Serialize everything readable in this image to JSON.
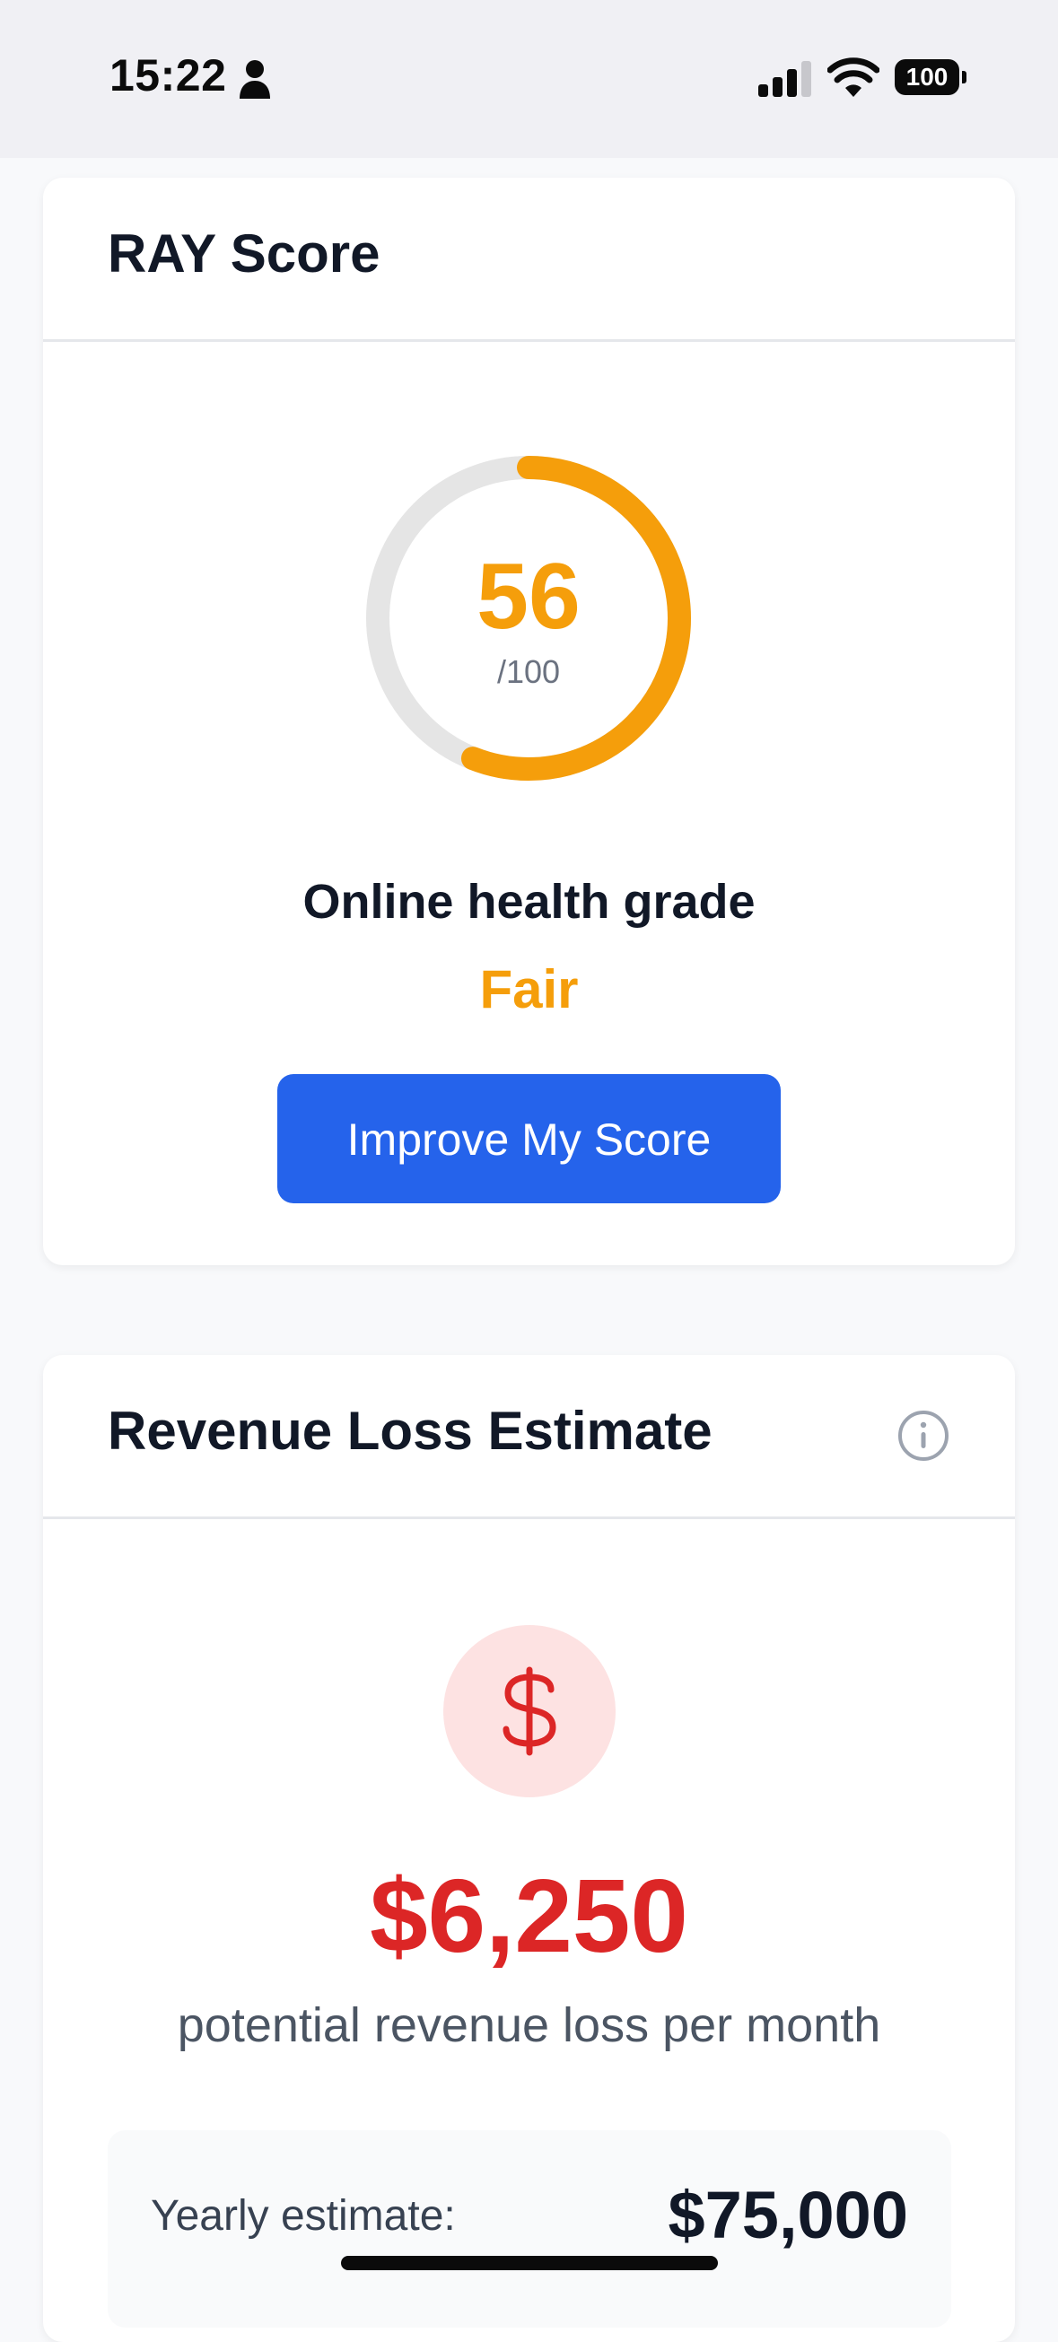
{
  "status_bar": {
    "time": "15:22",
    "battery": "100"
  },
  "score_card": {
    "title": "RAY Score",
    "score": "56",
    "score_max": "/100",
    "score_fraction": 0.56,
    "grade_label": "Online health grade",
    "grade": "Fair",
    "improve_button": "Improve My Score"
  },
  "revenue_card": {
    "title": "Revenue Loss Estimate",
    "amount": "$6,250",
    "caption": "potential revenue loss per month",
    "yearly_label": "Yearly estimate:",
    "yearly_value": "$75,000"
  },
  "colors": {
    "accent_orange": "#f59e0b",
    "primary_blue": "#2563eb",
    "loss_red": "#dc2626",
    "loss_red_bg": "#fde2e2"
  },
  "icons": {
    "person": "person-icon",
    "signal": "cellular-signal-icon",
    "wifi": "wifi-icon",
    "info": "info-icon",
    "dollar": "dollar-icon"
  }
}
